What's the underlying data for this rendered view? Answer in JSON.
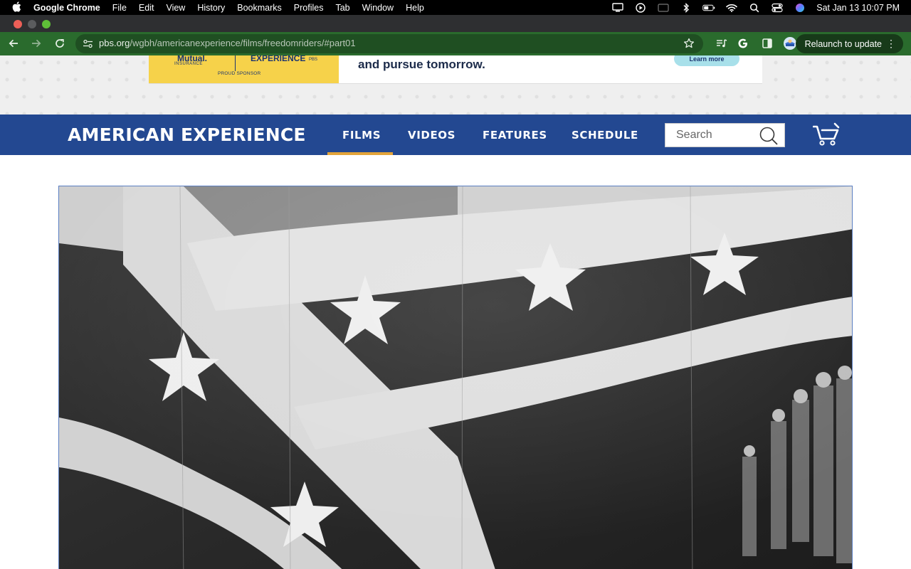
{
  "menubar": {
    "app": "Google Chrome",
    "menus": [
      "File",
      "Edit",
      "View",
      "History",
      "Bookmarks",
      "Profiles",
      "Tab",
      "Window",
      "Help"
    ],
    "datetime": "Sat Jan 13  10:07 PM"
  },
  "browser": {
    "url_host": "pbs.org",
    "url_path": "/wgbh/americanexperience/films/freedomriders/#part01",
    "relaunch_label": "Relaunch to update"
  },
  "ad": {
    "sponsor_name": "Mutual.",
    "sponsor_sub": "INSURANCE",
    "program_name": "EXPERIENCE",
    "network": "PBS",
    "proud_sponsor": "PROUD SPONSOR",
    "tagline": "and pursue tomorrow.",
    "cta": "Learn more"
  },
  "site": {
    "brand": "AMERICAN EXPERIENCE",
    "nav": [
      "FILMS",
      "VIDEOS",
      "FEATURES",
      "SCHEDULE"
    ],
    "active_nav": "FILMS",
    "search_placeholder": "Search",
    "accent_color": "#e3a43a",
    "navbar_color": "#234891"
  }
}
